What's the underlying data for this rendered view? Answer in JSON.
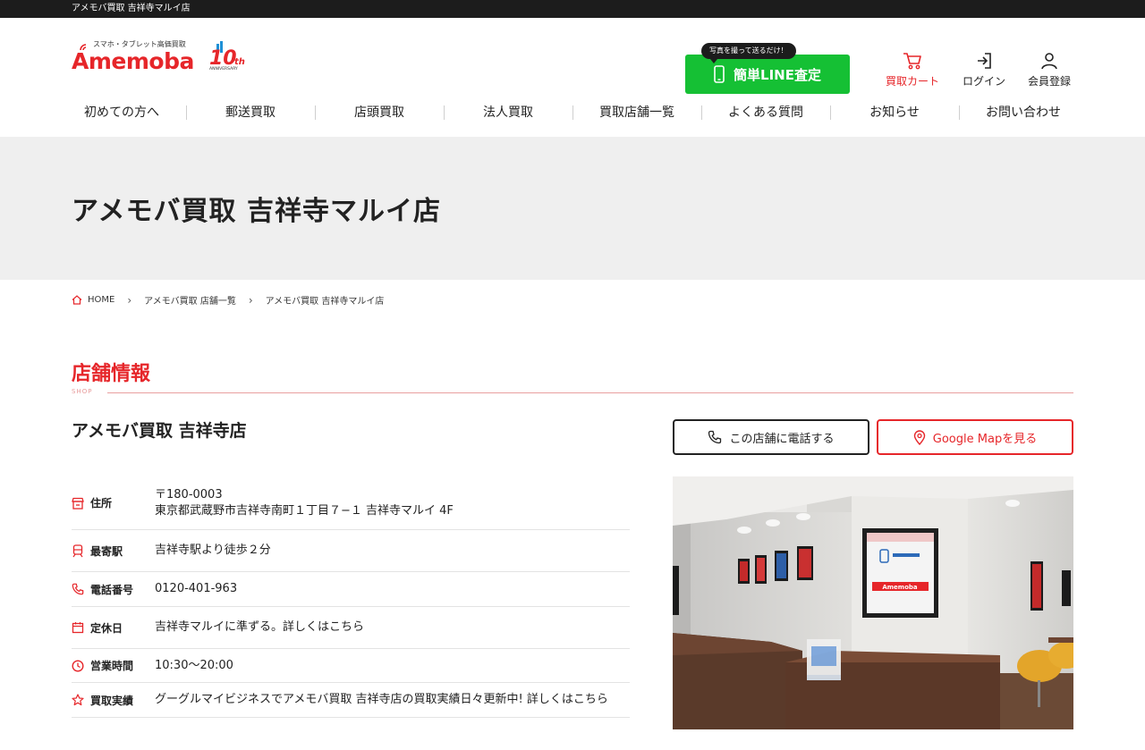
{
  "topbar": {
    "text": "アメモバ買取 吉祥寺マルイ店"
  },
  "logo": {
    "tagline": "スマホ・タブレット高価買取",
    "brand": "Amemoba",
    "anniv_num": "10",
    "anniv_suffix": "th",
    "anniv_label": "ANNIVERSARY"
  },
  "header": {
    "line_bubble": "写真を撮って送るだけ！",
    "line_button": "簡単LINE査定",
    "cart": "買取カート",
    "login": "ログイン",
    "register": "会員登録"
  },
  "nav": [
    "初めての方へ",
    "郵送買取",
    "店頭買取",
    "法人買取",
    "買取店舗一覧",
    "よくある質問",
    "お知らせ",
    "お問い合わせ"
  ],
  "hero": {
    "title": "アメモバ買取 吉祥寺マルイ店"
  },
  "breadcrumb": [
    "HOME",
    "アメモバ買取 店舗一覧",
    "アメモバ買取 吉祥寺マルイ店"
  ],
  "section": {
    "title": "店舗情報",
    "sub": "SHOP"
  },
  "store": {
    "name": "アメモバ買取 吉祥寺店",
    "call_button": "この店舗に電話する",
    "map_button": "Google Mapを見る"
  },
  "info": [
    {
      "label": "住所",
      "icon": "shop-icon",
      "value": "〒180-0003",
      "value2": "東京都武蔵野市吉祥寺南町１丁目７−１ 吉祥寺マルイ 4F"
    },
    {
      "label": "最寄駅",
      "icon": "train-icon",
      "value": "吉祥寺駅より徒歩２分"
    },
    {
      "label": "電話番号",
      "icon": "phone-icon",
      "value": "0120-401-963"
    },
    {
      "label": "定休日",
      "icon": "calendar-icon",
      "value": "吉祥寺マルイに準ずる。詳しくはこちら"
    },
    {
      "label": "営業時間",
      "icon": "clock-icon",
      "value": "10:30〜20:00"
    },
    {
      "label": "買取実績",
      "icon": "star-icon",
      "value": "グーグルマイビジネスでアメモバ買取 吉祥寺店の買取実績日々更新中! 詳しくはこちら"
    }
  ],
  "photo": {
    "poster_text": "Amemoba"
  },
  "colors": {
    "accent": "#e6262a",
    "line_green": "#15c034",
    "dark": "#1c1c1c"
  }
}
